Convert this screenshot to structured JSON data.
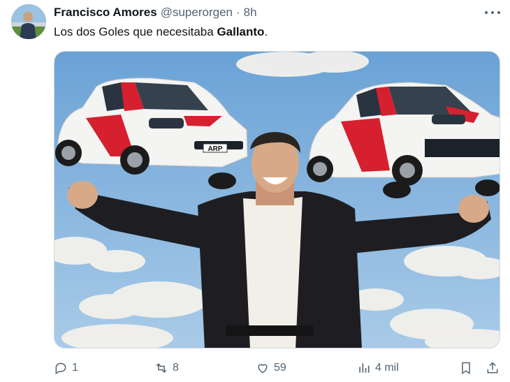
{
  "tweet": {
    "author_name": "Francisco Amores",
    "author_handle": "@superorgen",
    "separator": "·",
    "time": "8h",
    "text_before": "Los dos Goles que necesitaba ",
    "text_bold": "Gallanto",
    "text_after": "."
  },
  "media": {
    "plate_text": "ARP"
  },
  "actions": {
    "replies": "1",
    "reposts": "8",
    "likes": "59",
    "views": "4 mil"
  },
  "icons": [
    "more-icon",
    "reply-icon",
    "repost-icon",
    "like-icon",
    "views-icon",
    "bookmark-icon",
    "share-icon"
  ],
  "colors": {
    "text": "#0f1419",
    "secondary": "#536471",
    "sky": "#7fb0dc",
    "car_stripe": "#d6202f"
  }
}
